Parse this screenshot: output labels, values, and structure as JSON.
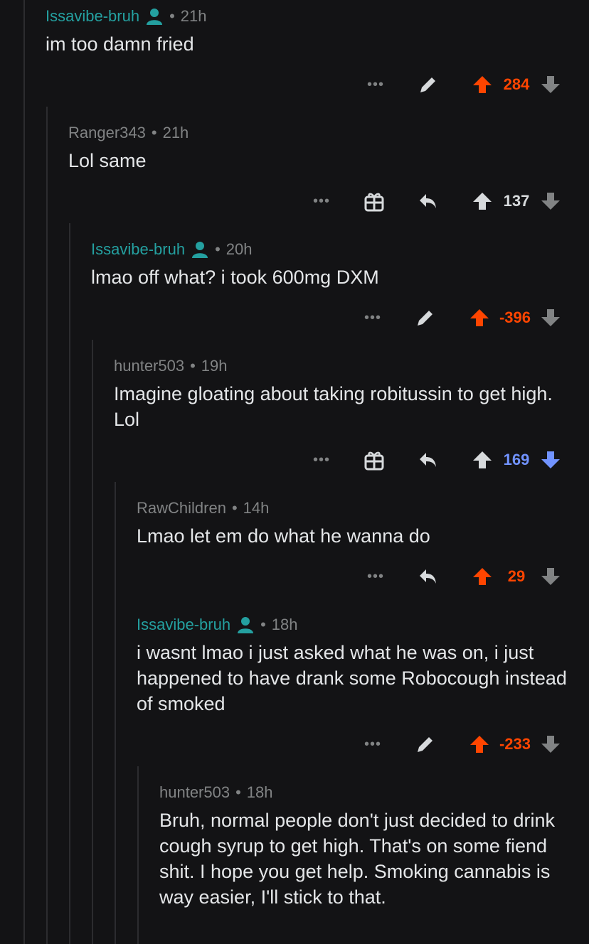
{
  "colors": {
    "background": "#131315",
    "op_name": "#24a0a0",
    "upvote": "#ff4500",
    "downvote": "#7193ff",
    "muted": "#818384"
  },
  "comments": [
    {
      "author": "Issavibe-bruh",
      "is_op": true,
      "time": "21h",
      "text": "im too damn fried",
      "actions": [
        "more-icon",
        "edit-icon"
      ],
      "score": "284",
      "vote": "up"
    },
    {
      "author": "Ranger343",
      "is_op": false,
      "time": "21h",
      "text": "Lol same",
      "actions": [
        "more-icon",
        "gift-icon",
        "reply-icon"
      ],
      "score": "137",
      "vote": "none"
    },
    {
      "author": "Issavibe-bruh",
      "is_op": true,
      "time": "20h",
      "text": "lmao off what? i took 600mg DXM",
      "actions": [
        "more-icon",
        "edit-icon"
      ],
      "score": "-396",
      "vote": "up"
    },
    {
      "author": "hunter503",
      "is_op": false,
      "time": "19h",
      "text": "Imagine gloating about taking robitussin to get high. Lol",
      "actions": [
        "more-icon",
        "gift-icon",
        "reply-icon"
      ],
      "score": "169",
      "vote": "down"
    },
    {
      "author": "RawChildren",
      "is_op": false,
      "time": "14h",
      "text": "Lmao let em do what he wanna do",
      "actions": [
        "more-icon",
        "reply-icon"
      ],
      "score": "29",
      "vote": "up"
    },
    {
      "author": "Issavibe-bruh",
      "is_op": true,
      "time": "18h",
      "text": "i wasnt lmao i just asked what he was on, i just happened to have drank some Robocough instead of smoked",
      "actions": [
        "more-icon",
        "edit-icon"
      ],
      "score": "-233",
      "vote": "up"
    },
    {
      "author": "hunter503",
      "is_op": false,
      "time": "18h",
      "text": "Bruh, normal people don't just decided to drink cough syrup to get high. That's on some fiend shit. I hope you get help. Smoking cannabis is way easier, I'll stick to that.",
      "actions": [],
      "score": "",
      "vote": "none"
    }
  ]
}
